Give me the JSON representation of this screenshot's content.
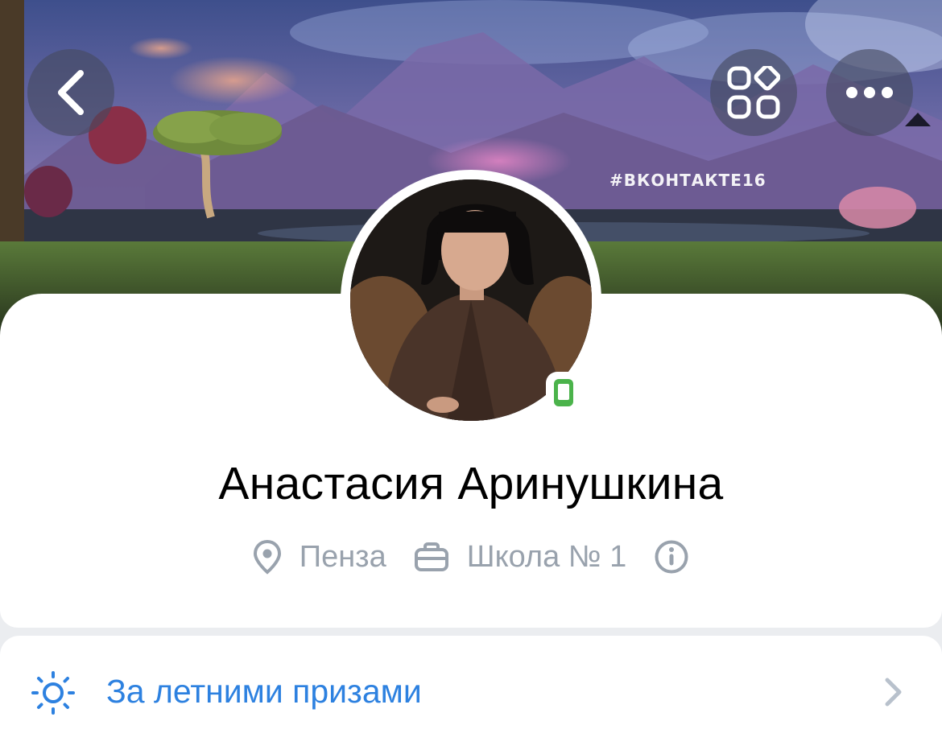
{
  "cover": {
    "hashtag": "#ВКОНТАКТЕ16"
  },
  "header": {
    "back_icon": "chevron-left-icon",
    "apps_icon": "apps-grid-icon",
    "more_icon": "more-horizontal-icon"
  },
  "profile": {
    "name": "Анастасия Аринушкина",
    "city": "Пенза",
    "work": "Школа № 1",
    "online_status_icon": "mobile-online-icon",
    "online_color": "#4bb34b"
  },
  "status": {
    "label": "За летними призами",
    "icon": "sun-icon",
    "accent_color": "#2d81e0"
  }
}
